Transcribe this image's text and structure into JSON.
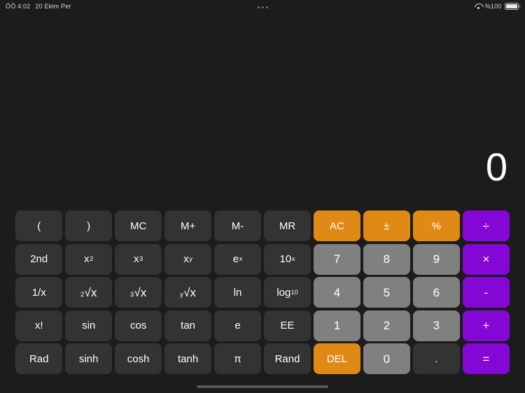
{
  "status_bar": {
    "time": "ÖÖ 4:02",
    "date": "20 Ekim Per",
    "multitask_icon": "three-dots-icon",
    "wifi_icon": "wifi-icon",
    "battery_percent": "%100",
    "battery_icon": "battery-full-icon"
  },
  "display": {
    "value": "0"
  },
  "keypad": {
    "rows": [
      [
        {
          "label": "(",
          "name": "paren-open",
          "style": "fn"
        },
        {
          "label": ")",
          "name": "paren-close",
          "style": "fn"
        },
        {
          "label": "MC",
          "name": "memory-clear",
          "style": "fn"
        },
        {
          "label": "M+",
          "name": "memory-add",
          "style": "fn"
        },
        {
          "label": "M-",
          "name": "memory-subtract",
          "style": "fn"
        },
        {
          "label": "MR",
          "name": "memory-recall",
          "style": "fn"
        },
        {
          "label": "AC",
          "name": "all-clear",
          "style": "accent"
        },
        {
          "label": "±",
          "name": "sign-toggle",
          "style": "accent"
        },
        {
          "label": "%",
          "name": "percent",
          "style": "accent"
        },
        {
          "label": "÷",
          "name": "divide",
          "style": "op"
        }
      ],
      [
        {
          "label": "2nd",
          "name": "second-function",
          "style": "fn"
        },
        {
          "label": "x²",
          "name": "square",
          "style": "fn",
          "base": "x",
          "sup": "2"
        },
        {
          "label": "x³",
          "name": "cube",
          "style": "fn",
          "base": "x",
          "sup": "3"
        },
        {
          "label": "xʸ",
          "name": "power-y",
          "style": "fn",
          "base": "x",
          "sup": "y"
        },
        {
          "label": "eˣ",
          "name": "exp-e",
          "style": "fn",
          "base": "e",
          "sup": "x"
        },
        {
          "label": "10ˣ",
          "name": "exp-ten",
          "style": "fn",
          "base": "10",
          "sup": "x"
        },
        {
          "label": "7",
          "name": "digit-7",
          "style": "digit"
        },
        {
          "label": "8",
          "name": "digit-8",
          "style": "digit"
        },
        {
          "label": "9",
          "name": "digit-9",
          "style": "digit"
        },
        {
          "label": "×",
          "name": "multiply",
          "style": "op"
        }
      ],
      [
        {
          "label": "1/x",
          "name": "reciprocal",
          "style": "fn"
        },
        {
          "label": "²√x",
          "name": "square-root",
          "style": "fn",
          "pre": "2",
          "glyph": "√x"
        },
        {
          "label": "³√x",
          "name": "cube-root",
          "style": "fn",
          "pre": "3",
          "glyph": "√x"
        },
        {
          "label": "ʸ√x",
          "name": "nth-root",
          "style": "fn",
          "pre": "y",
          "glyph": "√x"
        },
        {
          "label": "ln",
          "name": "natural-log",
          "style": "fn"
        },
        {
          "label": "log₁₀",
          "name": "log-base-ten",
          "style": "fn",
          "base": "log",
          "sub": "10"
        },
        {
          "label": "4",
          "name": "digit-4",
          "style": "digit"
        },
        {
          "label": "5",
          "name": "digit-5",
          "style": "digit"
        },
        {
          "label": "6",
          "name": "digit-6",
          "style": "digit"
        },
        {
          "label": "-",
          "name": "subtract",
          "style": "op"
        }
      ],
      [
        {
          "label": "x!",
          "name": "factorial",
          "style": "fn"
        },
        {
          "label": "sin",
          "name": "sine",
          "style": "fn"
        },
        {
          "label": "cos",
          "name": "cosine",
          "style": "fn"
        },
        {
          "label": "tan",
          "name": "tangent",
          "style": "fn"
        },
        {
          "label": "e",
          "name": "euler-number",
          "style": "fn"
        },
        {
          "label": "EE",
          "name": "exponent-entry",
          "style": "fn"
        },
        {
          "label": "1",
          "name": "digit-1",
          "style": "digit"
        },
        {
          "label": "2",
          "name": "digit-2",
          "style": "digit"
        },
        {
          "label": "3",
          "name": "digit-3",
          "style": "digit"
        },
        {
          "label": "+",
          "name": "add",
          "style": "op"
        }
      ],
      [
        {
          "label": "Rad",
          "name": "radian-mode",
          "style": "fn"
        },
        {
          "label": "sinh",
          "name": "hyperbolic-sine",
          "style": "fn"
        },
        {
          "label": "cosh",
          "name": "hyperbolic-cosine",
          "style": "fn"
        },
        {
          "label": "tanh",
          "name": "hyperbolic-tangent",
          "style": "fn"
        },
        {
          "label": "π",
          "name": "pi",
          "style": "fn"
        },
        {
          "label": "Rand",
          "name": "random",
          "style": "fn"
        },
        {
          "label": "DEL",
          "name": "delete",
          "style": "accent"
        },
        {
          "label": "0",
          "name": "digit-0",
          "style": "digit"
        },
        {
          "label": ".",
          "name": "decimal-point",
          "style": "fn"
        },
        {
          "label": "=",
          "name": "equals",
          "style": "op"
        }
      ]
    ]
  },
  "colors": {
    "background": "#1c1c1c",
    "function_key": "#333333",
    "digit_key": "#808080",
    "accent_key": "#e08a16",
    "operator_key": "#8407d6",
    "display_text": "#ffffff",
    "home_indicator": "#565656"
  }
}
